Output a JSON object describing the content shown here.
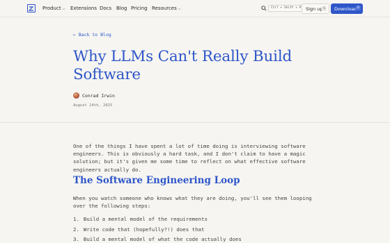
{
  "nav": {
    "items": [
      {
        "label": "Product",
        "has_menu": true
      },
      {
        "label": "Extensions",
        "has_menu": false
      },
      {
        "label": "Docs",
        "has_menu": false
      },
      {
        "label": "Blog",
        "has_menu": false
      },
      {
        "label": "Pricing",
        "has_menu": false
      },
      {
        "label": "Resources",
        "has_menu": true
      }
    ],
    "search_shortcut": "Ctrl + Shift + P",
    "signup": {
      "label": "Sign up",
      "shortcut": "S"
    },
    "download": {
      "label": "Download",
      "shortcut": "D"
    }
  },
  "article": {
    "back_link": "← Back to Blog",
    "title": "Why LLMs Can't Really Build Software",
    "author": "Conrad Irwin",
    "date": "August 14th, 2025",
    "intro": "One of the things I have spent a lot of time doing is interviewing software engineers. This is obviously a hard task, and I don't claim to have a magic solution; but it's given me some time to reflect on what effective software engineers actually do.",
    "section_heading": "The Software Engineering Loop",
    "section_intro": "When you watch someone who knows what they are doing, you'll see them looping over the following steps:",
    "steps": [
      {
        "num": "1.",
        "text": "Build a mental model of the requirements"
      },
      {
        "num": "2.",
        "text": "Write code that (hopefully?!) does that"
      },
      {
        "num": "3.",
        "text": "Build a mental model of what the code actually does"
      }
    ]
  },
  "colors": {
    "accent": "#2e56c9",
    "background": "#f6f5f1"
  }
}
